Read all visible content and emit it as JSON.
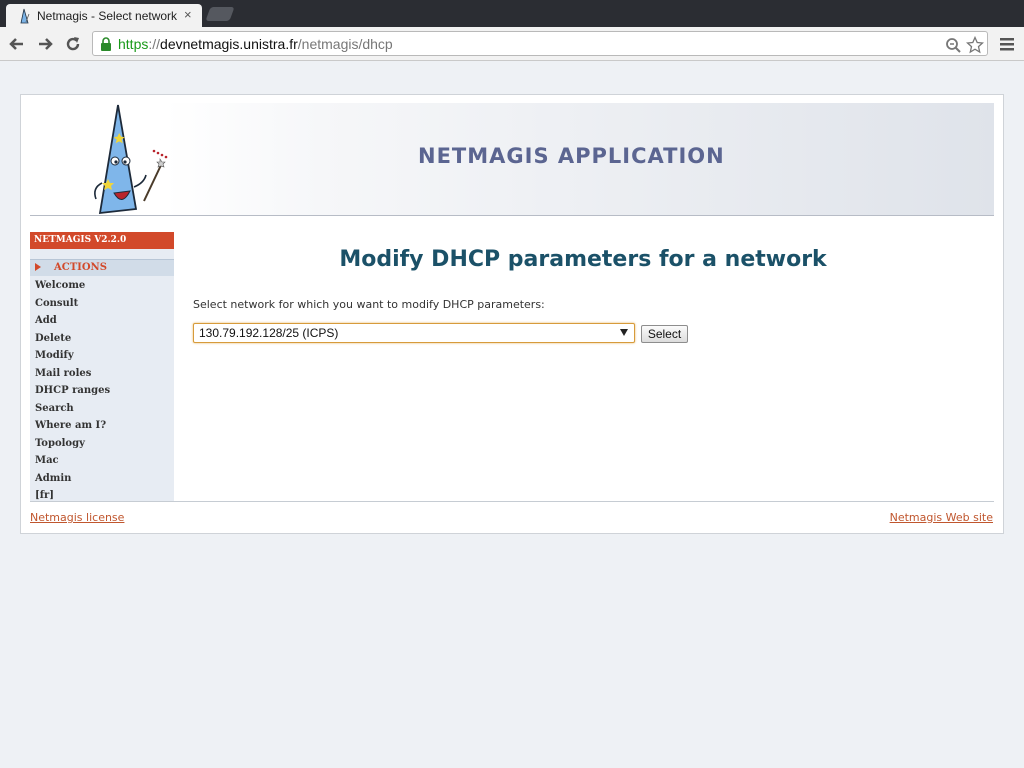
{
  "browser": {
    "tab_title": "Netmagis - Select network",
    "tab_close": "×",
    "url": {
      "scheme": "https",
      "separator": "://",
      "host": "devnetmagis.unistra.fr",
      "path": "/netmagis/dhcp"
    },
    "icons": {
      "favicon": "wizard-hat-icon",
      "back": "back-arrow-icon",
      "forward": "forward-arrow-icon",
      "reload": "reload-icon",
      "lock": "lock-icon",
      "zoom": "magnifier-icon",
      "bookmark": "star-icon",
      "menu": "hamburger-menu-icon"
    }
  },
  "banner": {
    "title": "NETMAGIS APPLICATION"
  },
  "sidebar": {
    "version": "NETMAGIS V2.2.0",
    "section": "ACTIONS",
    "items": [
      {
        "label": "Welcome"
      },
      {
        "label": "Consult"
      },
      {
        "label": "Add"
      },
      {
        "label": "Delete"
      },
      {
        "label": "Modify"
      },
      {
        "label": "Mail roles"
      },
      {
        "label": "DHCP ranges"
      },
      {
        "label": "Search"
      },
      {
        "label": "Where am I?"
      },
      {
        "label": "Topology"
      },
      {
        "label": "Mac"
      },
      {
        "label": "Admin"
      },
      {
        "label": "[fr]"
      }
    ]
  },
  "main": {
    "title": "Modify DHCP parameters for a network",
    "instruction": "Select network for which you want to modify DHCP parameters:",
    "network_select": {
      "selected": "130.79.192.128/25 (ICPS)"
    },
    "select_button": "Select"
  },
  "footer": {
    "license_link": "Netmagis license",
    "website_link": "Netmagis Web site"
  },
  "colors": {
    "accent_orange": "#d2492a",
    "title_teal": "#1b5168",
    "banner_title": "#5b6591",
    "link": "#c0562e"
  }
}
